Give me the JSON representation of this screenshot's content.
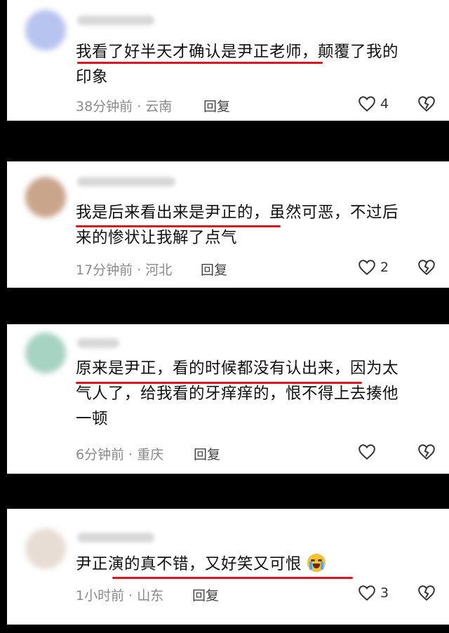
{
  "comments": [
    {
      "text_line1": "我看了好半天才确认是尹正老师，颠覆了我的",
      "text_line2": "印象",
      "time_location": "38分钟前 · 云南",
      "reply_label": "回复",
      "like_count": "4",
      "avatar_color": "#b8c4f0"
    },
    {
      "text_line1": "我是后来看出来是尹正的，虽然可恶，不过后",
      "text_line2": "来的惨状让我解了点气",
      "time_location": "17分钟前 · 河北",
      "reply_label": "回复",
      "like_count": "2",
      "avatar_color": "#c9a58c"
    },
    {
      "text_line1": "原来是尹正，看的时候都没有认出来，因为太",
      "text_line2": "气人了，给我看的牙痒痒的，恨不得上去揍他",
      "text_line3": "一顿",
      "time_location": "6分钟前 · 重庆",
      "reply_label": "回复",
      "like_count": "",
      "avatar_color": "#a7d3c2"
    },
    {
      "text_line1": "尹正演的真不错，又好笑又可恨",
      "emoji": "loudly-crying-face",
      "time_location": "1小时前 · 山东",
      "reply_label": "回复",
      "like_count": "3",
      "avatar_color": "#e8ddd5"
    }
  ],
  "colors": {
    "underline": "#e0141b",
    "background": "#000000",
    "card": "#ffffff",
    "meta_text": "#8a8a8a"
  }
}
